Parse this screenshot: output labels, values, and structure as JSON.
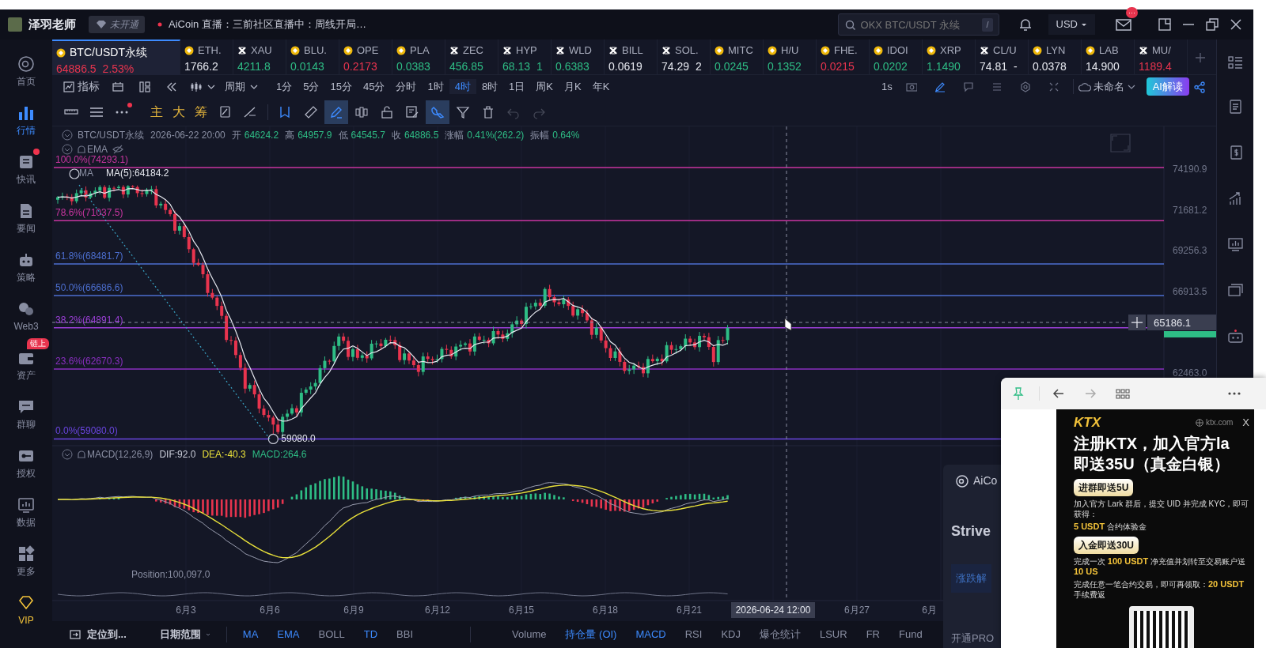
{
  "top_bar": {
    "user_name": "泽羽老师",
    "membership_badge": "未开通",
    "live_text": "AiCoin 直播：三前社区直播中：周线开局…",
    "search": {
      "placeholder": "OKX BTC/USDT 永续",
      "shortcut": "/"
    },
    "currency": "USD",
    "mail_badge": "···"
  },
  "sidebar": {
    "items": [
      {
        "label": "首页",
        "selected": false,
        "dot": false,
        "kind": "nav"
      },
      {
        "label": "行情",
        "selected": true,
        "dot": false,
        "kind": "nav"
      },
      {
        "label": "快讯",
        "selected": false,
        "dot": true,
        "kind": "nav"
      },
      {
        "label": "要闻",
        "selected": false,
        "dot": false,
        "kind": "nav"
      },
      {
        "label": "策略",
        "selected": false,
        "dot": false,
        "kind": "nav"
      },
      {
        "label": "Web3",
        "selected": false,
        "dot": false,
        "kind": "nav"
      },
      {
        "label": "资产",
        "selected": false,
        "dot": false,
        "kind": "nav",
        "badge": "链上"
      },
      {
        "label": "群聊",
        "selected": false,
        "dot": false,
        "kind": "nav"
      },
      {
        "label": "授权",
        "selected": false,
        "dot": false,
        "kind": "nav"
      },
      {
        "label": "数据",
        "selected": false,
        "dot": false,
        "kind": "nav"
      },
      {
        "label": "更多",
        "selected": false,
        "dot": false,
        "kind": "nav"
      },
      {
        "label": "VIP",
        "selected": false,
        "dot": false,
        "kind": "vip"
      }
    ]
  },
  "tickers": [
    {
      "name": "BTC/USDT永续",
      "price": "64886.5",
      "change": "2.53%",
      "color": "#e8344e",
      "kind": "coin",
      "selected": true
    },
    {
      "name": "ETH.",
      "price": "1766.2",
      "color": "#e6e8ef",
      "kind": "coin",
      "selected": false
    },
    {
      "name": "XAU",
      "price": "4211.8",
      "color": "#2ebd85",
      "kind": "cross",
      "selected": false
    },
    {
      "name": "BLU.",
      "price": "0.0143",
      "color": "#2ebd85",
      "kind": "coin",
      "selected": false
    },
    {
      "name": "OPE",
      "price": "0.2173",
      "color": "#e8344e",
      "kind": "coin",
      "selected": false
    },
    {
      "name": "PLA",
      "price": "0.0383",
      "color": "#2ebd85",
      "kind": "coin",
      "selected": false
    },
    {
      "name": "ZEC",
      "price": "456.85",
      "color": "#2ebd85",
      "kind": "cross",
      "selected": false
    },
    {
      "name": "HYP",
      "price": "68.13",
      "change": "1",
      "color": "#2ebd85",
      "kind": "cross",
      "selected": false
    },
    {
      "name": "WLD",
      "price": "0.6383",
      "color": "#2ebd85",
      "kind": "cross",
      "selected": false
    },
    {
      "name": "BILL",
      "price": "0.0619",
      "color": "#e6e8ef",
      "kind": "cross",
      "selected": false
    },
    {
      "name": "SOL.",
      "price": "74.29",
      "change": "2",
      "color": "#e6e8ef",
      "kind": "cross",
      "selected": false
    },
    {
      "name": "MITC",
      "price": "0.0245",
      "color": "#2ebd85",
      "kind": "coin",
      "selected": false
    },
    {
      "name": "H/U",
      "price": "0.1352",
      "color": "#2ebd85",
      "kind": "coin",
      "selected": false
    },
    {
      "name": "FHE.",
      "price": "0.0215",
      "color": "#e8344e",
      "kind": "coin",
      "selected": false
    },
    {
      "name": "IDOI",
      "price": "0.0202",
      "color": "#2ebd85",
      "kind": "coin",
      "selected": false
    },
    {
      "name": "XRP",
      "price": "1.1490",
      "color": "#2ebd85",
      "kind": "coin",
      "selected": false
    },
    {
      "name": "CL/U",
      "price": "74.81",
      "change": "-",
      "color": "#e6e8ef",
      "kind": "cross",
      "selected": false
    },
    {
      "name": "LYN",
      "price": "0.0378",
      "color": "#e6e8ef",
      "kind": "coin",
      "selected": false
    },
    {
      "name": "LAB",
      "price": "14.900",
      "color": "#e6e8ef",
      "kind": "coin",
      "selected": false
    },
    {
      "name": "MU/",
      "price": "1189.4",
      "color": "#e8344e",
      "kind": "cross",
      "selected": false
    }
  ],
  "toolbar": {
    "indicator_label": "指标",
    "period_label": "周期",
    "periods": [
      {
        "label": "1分",
        "selected": false
      },
      {
        "label": "5分",
        "selected": false
      },
      {
        "label": "15分",
        "selected": false
      },
      {
        "label": "45分",
        "selected": false
      },
      {
        "label": "分时",
        "selected": false
      },
      {
        "label": "1时",
        "selected": false
      },
      {
        "label": "4时",
        "selected": true
      },
      {
        "label": "8时",
        "selected": false
      },
      {
        "label": "1日",
        "selected": false
      },
      {
        "label": "周K",
        "selected": false
      },
      {
        "label": "月K",
        "selected": false
      },
      {
        "label": "年K",
        "selected": false
      }
    ],
    "refresh": "1s",
    "layout_name": "未命名",
    "ai_button": "AI解读"
  },
  "drawing_toolbar": {
    "left_tools": [
      {
        "dot": false
      },
      {
        "dot": false
      },
      {
        "dot": true
      }
    ],
    "labels": [
      "主",
      "大",
      "筹"
    ],
    "tools": [
      {
        "selected": false,
        "disabled": false
      },
      {
        "selected": false,
        "disabled": false
      },
      {
        "selected": false,
        "disabled": false
      },
      {
        "selected": false,
        "disabled": false
      },
      {
        "selected": true,
        "disabled": false
      },
      {
        "selected": false,
        "disabled": false
      },
      {
        "selected": false,
        "disabled": false
      },
      {
        "selected": false,
        "disabled": false
      },
      {
        "selected": true,
        "disabled": false
      },
      {
        "selected": false,
        "disabled": false
      },
      {
        "selected": false,
        "disabled": false
      },
      {
        "selected": false,
        "disabled": true
      },
      {
        "selected": false,
        "disabled": true
      }
    ]
  },
  "chart": {
    "info": {
      "symbol": "BTC/USDT永续",
      "time": "2026-06-22 20:00",
      "fields": [
        {
          "label": "开",
          "value": "64624.2"
        },
        {
          "label": "高",
          "value": "64957.9"
        },
        {
          "label": "低",
          "value": "64545.7"
        },
        {
          "label": "收",
          "value": "64886.5"
        },
        {
          "label": "涨幅",
          "value": "0.41%(262.2)"
        },
        {
          "label": "振幅",
          "value": "0.64%"
        }
      ]
    },
    "ema_legend": "EMA",
    "ma_legend": {
      "name": "MA",
      "value": "MA(5):64184.2"
    },
    "fib_levels": [
      {
        "label": "100.0%(74293.1)",
        "color": "#c8359f"
      },
      {
        "label": "78.6%(71037.5)",
        "color": "#c8359f"
      },
      {
        "label": "61.8%(68481.7)",
        "color": "#4c6fd0"
      },
      {
        "label": "50.0%(66686.6)",
        "color": "#4c6fd0"
      },
      {
        "label": "38.2%(64891.4)",
        "color": "#9b3fd6"
      },
      {
        "label": "23.6%(62670.3)",
        "color": "#8a2fc0"
      },
      {
        "label": "0.0%(59080.0)",
        "color": "#6a45e0"
      }
    ],
    "price_axis": [
      {
        "label": "74190.9",
        "kind": "tick"
      },
      {
        "label": "71681.2",
        "kind": "tick"
      },
      {
        "label": "69256.3",
        "kind": "tick"
      },
      {
        "label": "66913.5",
        "kind": "tick"
      },
      {
        "label": "65186.1",
        "kind": "cursor"
      },
      {
        "label": "62463.0",
        "kind": "tick"
      }
    ],
    "low_label": "59080.0",
    "macd_legend": {
      "name": "MACD(12,26,9)",
      "dif": "DIF:92.0",
      "dea": "DEA:-40.3",
      "macd": "MACD:264.6"
    },
    "position_legend": "Position:100,097.0",
    "x_axis": [
      {
        "label": "6月3",
        "kind": "tick"
      },
      {
        "label": "6月6",
        "kind": "tick"
      },
      {
        "label": "6月9",
        "kind": "tick"
      },
      {
        "label": "6月12",
        "kind": "tick"
      },
      {
        "label": "6月15",
        "kind": "tick"
      },
      {
        "label": "6月18",
        "kind": "tick"
      },
      {
        "label": "6月21",
        "kind": "tick"
      },
      {
        "label": "2026-06-24 12:00",
        "kind": "cursor"
      },
      {
        "label": "6月27",
        "kind": "tick"
      },
      {
        "label": "6月",
        "kind": "tick"
      }
    ]
  },
  "bottom_bar": {
    "locate": "定位到...",
    "date_range": "日期范围",
    "main_indicators": [
      {
        "label": "MA",
        "selected": true
      },
      {
        "label": "EMA",
        "selected": true
      },
      {
        "label": "BOLL",
        "selected": false
      },
      {
        "label": "TD",
        "selected": true
      },
      {
        "label": "BBI",
        "selected": false
      }
    ],
    "sub_indicators": [
      {
        "label": "Volume",
        "selected": false
      },
      {
        "label": "持仓量 (OI)",
        "selected": true
      },
      {
        "label": "MACD",
        "selected": true
      },
      {
        "label": "RSI",
        "selected": false
      },
      {
        "label": "KDJ",
        "selected": false
      },
      {
        "label": "爆仓统计",
        "selected": false
      },
      {
        "label": "LSUR",
        "selected": false
      },
      {
        "label": "FR",
        "selected": false
      },
      {
        "label": "Fund",
        "selected": false
      }
    ]
  },
  "ai_card": {
    "title": "AiCo",
    "heading": "Strive",
    "button": "涨跌解",
    "footer": "开通PRO"
  },
  "popup": {
    "ad": {
      "logo": "KTX",
      "domain": "ktx.com",
      "close": "X",
      "headline": [
        "注册KTX，加入官方la",
        "即送35U（真金白银）"
      ],
      "offers": [
        {
          "pill": "进群即送5U",
          "lines": [
            "加入官方 Lark 群后，提交 UID 并完成 KYC，即可获得：",
            "**5 USDT** 合约体验金"
          ]
        },
        {
          "pill": "入金即送30U",
          "lines": [
            "完成一次 **100 USDT** 净充值并划转至交易账户送**10 US**",
            "完成任意一笔合约交易，即可再领取：**20 USDT** 手续费返"
          ]
        }
      ]
    }
  }
}
